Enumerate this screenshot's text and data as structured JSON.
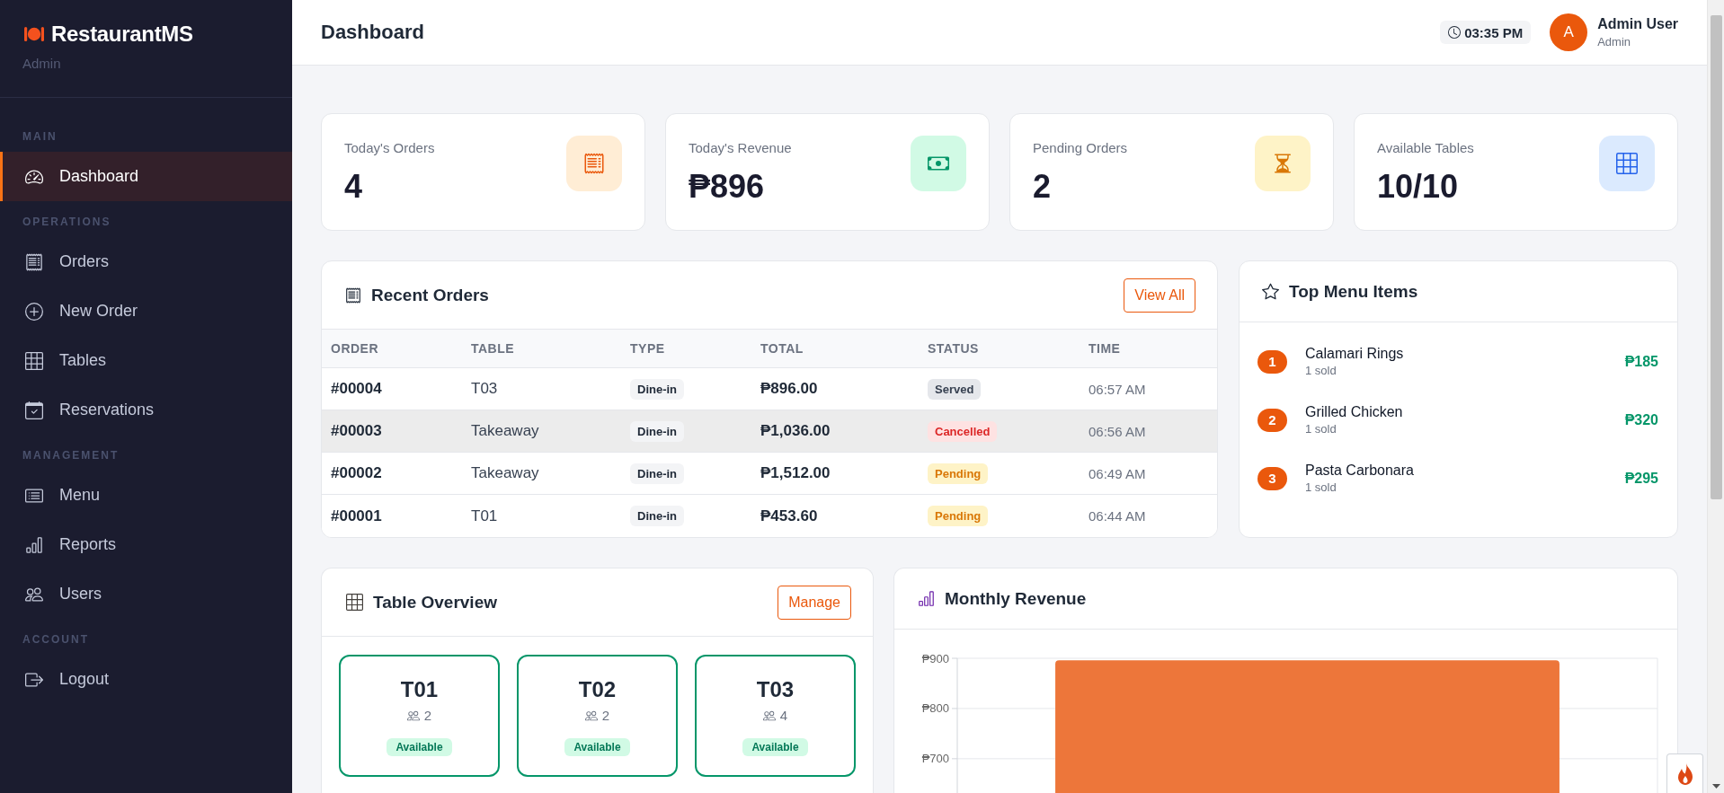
{
  "sidebar": {
    "brand": "RestaurantMS",
    "role": "Admin",
    "sections": [
      {
        "title": "MAIN",
        "items": [
          {
            "label": "Dashboard",
            "kind": "dashboard",
            "selected": true
          }
        ]
      },
      {
        "title": "OPERATIONS",
        "items": [
          {
            "label": "Orders",
            "kind": "orders",
            "selected": false
          },
          {
            "label": "New Order",
            "kind": "new-order",
            "selected": false
          },
          {
            "label": "Tables",
            "kind": "tables",
            "selected": false
          },
          {
            "label": "Reservations",
            "kind": "reservations",
            "selected": false
          }
        ]
      },
      {
        "title": "MANAGEMENT",
        "items": [
          {
            "label": "Menu",
            "kind": "menu",
            "selected": false
          },
          {
            "label": "Reports",
            "kind": "reports",
            "selected": false
          },
          {
            "label": "Users",
            "kind": "users",
            "selected": false
          }
        ]
      },
      {
        "title": "ACCOUNT",
        "items": [
          {
            "label": "Logout",
            "kind": "logout",
            "selected": false
          }
        ]
      }
    ]
  },
  "header": {
    "title": "Dashboard",
    "time": "03:35 PM",
    "user": {
      "initial": "A",
      "name": "Admin User",
      "role": "Admin"
    }
  },
  "stats": [
    {
      "kind": "orders",
      "label": "Today's Orders",
      "value": "4"
    },
    {
      "kind": "revenue",
      "label": "Today's Revenue",
      "value": "₱896"
    },
    {
      "kind": "pending",
      "label": "Pending Orders",
      "value": "2"
    },
    {
      "kind": "tables",
      "label": "Available Tables",
      "value": "10/10"
    }
  ],
  "recent_orders": {
    "title": "Recent Orders",
    "action": "View All",
    "columns": [
      "ORDER",
      "TABLE",
      "TYPE",
      "TOTAL",
      "STATUS",
      "TIME"
    ],
    "rows": [
      {
        "order": "#00004",
        "table": "T03",
        "type": "Dine-in",
        "total": "₱896.00",
        "status": {
          "label": "Served",
          "kind": "served"
        },
        "time": "06:57 AM",
        "highlighted": false
      },
      {
        "order": "#00003",
        "table": "Takeaway",
        "type": "Dine-in",
        "total": "₱1,036.00",
        "status": {
          "label": "Cancelled",
          "kind": "cancelled"
        },
        "time": "06:56 AM",
        "highlighted": true
      },
      {
        "order": "#00002",
        "table": "Takeaway",
        "type": "Dine-in",
        "total": "₱1,512.00",
        "status": {
          "label": "Pending",
          "kind": "pending"
        },
        "time": "06:49 AM",
        "highlighted": false
      },
      {
        "order": "#00001",
        "table": "T01",
        "type": "Dine-in",
        "total": "₱453.60",
        "status": {
          "label": "Pending",
          "kind": "pending"
        },
        "time": "06:44 AM",
        "highlighted": false
      }
    ]
  },
  "top_menu_items": {
    "title": "Top Menu Items",
    "items": [
      {
        "rank": "1",
        "name": "Calamari Rings",
        "sold": "1 sold",
        "price": "₱185"
      },
      {
        "rank": "2",
        "name": "Grilled Chicken",
        "sold": "1 sold",
        "price": "₱320"
      },
      {
        "rank": "3",
        "name": "Pasta Carbonara",
        "sold": "1 sold",
        "price": "₱295"
      }
    ]
  },
  "table_overview": {
    "title": "Table Overview",
    "action": "Manage",
    "tables": [
      {
        "name": "T01",
        "capacity": "2",
        "status": {
          "label": "Available",
          "kind": "available"
        }
      },
      {
        "name": "T02",
        "capacity": "2",
        "status": {
          "label": "Available",
          "kind": "available"
        }
      },
      {
        "name": "T03",
        "capacity": "4",
        "status": {
          "label": "Available",
          "kind": "available"
        }
      }
    ]
  },
  "monthly_revenue": {
    "title": "Monthly Revenue",
    "chart_data": {
      "type": "bar",
      "values": [
        896
      ],
      "ylim": [
        630,
        900
      ],
      "yticks": [
        {
          "value": 900,
          "label": "₱900"
        },
        {
          "value": 800,
          "label": "₱800"
        },
        {
          "value": 700,
          "label": "₱700"
        }
      ]
    }
  }
}
